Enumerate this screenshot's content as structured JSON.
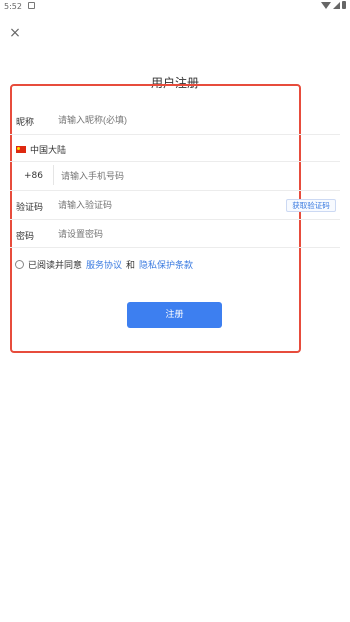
{
  "status_bar": {
    "time": "5:52"
  },
  "header": {
    "close_label": "×",
    "title": "用户注册"
  },
  "form": {
    "nickname_label": "昵称",
    "nickname_placeholder": "请输入昵称(必填)",
    "region": "中国大陆",
    "country_code": "+86",
    "phone_placeholder": "请输入手机号码",
    "code_label": "验证码",
    "code_placeholder": "请输入验证码",
    "get_code_button": "获取验证码",
    "password_label": "密码",
    "password_placeholder": "请设置密码"
  },
  "agreement": {
    "prefix": "已阅读并同意",
    "service_link": "服务协议",
    "conj": "和",
    "privacy_link": "隐私保护条款"
  },
  "submit_label": "注册",
  "colors": {
    "accent": "#3d7ff0",
    "link": "#3b7be0",
    "highlight_frame": "#e74c3c"
  }
}
